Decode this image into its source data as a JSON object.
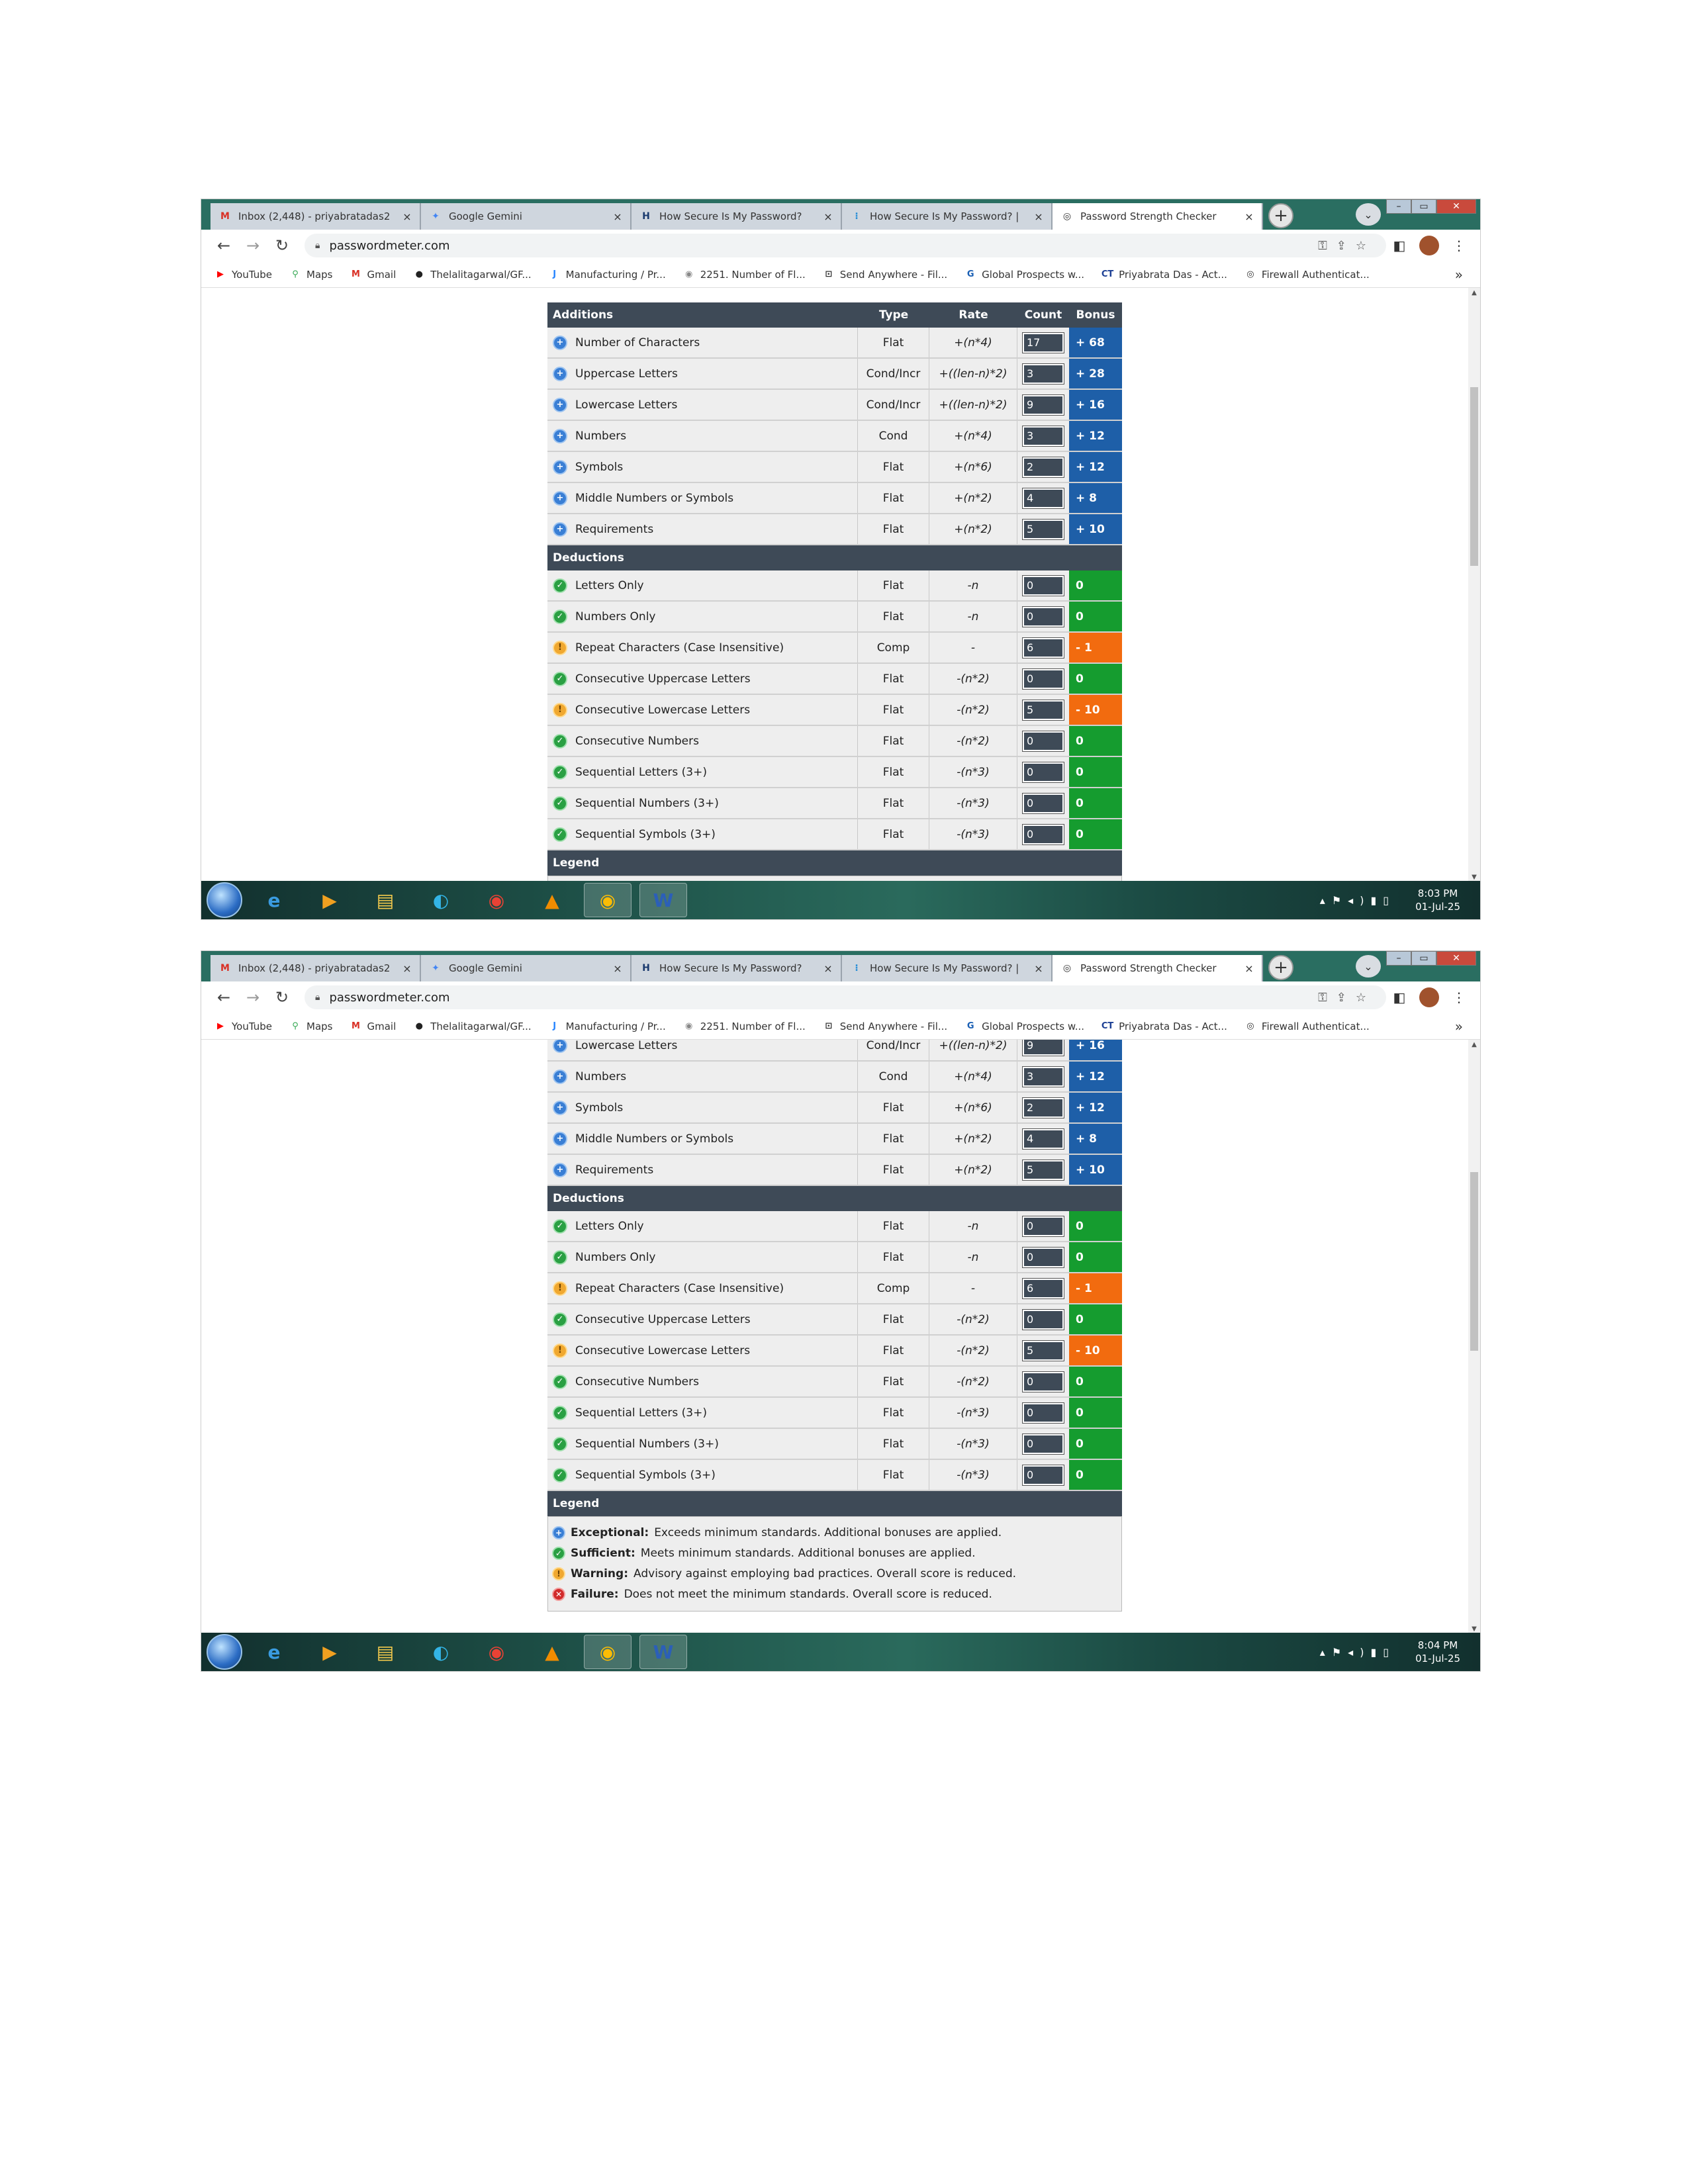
{
  "browser": {
    "tabs": [
      {
        "label": "Inbox (2,448) - priyabratadas2",
        "icon": "gmail-icon",
        "icon_glyph": "M",
        "icon_color": "#d93025",
        "active": false
      },
      {
        "label": "Google Gemini",
        "icon": "gemini-icon",
        "icon_glyph": "✦",
        "icon_color": "#4285f4",
        "active": false
      },
      {
        "label": "How Secure Is My Password?",
        "icon": "hsimp-icon",
        "icon_glyph": "H",
        "icon_color": "#1a3a6e",
        "active": false
      },
      {
        "label": "How Secure Is My Password? |",
        "icon": "hsimp-blue-icon",
        "icon_glyph": "⁝",
        "icon_color": "#2a8fd6",
        "active": false
      },
      {
        "label": "Password Strength Checker",
        "icon": "passwordmeter-icon",
        "icon_glyph": "◎",
        "icon_color": "#333333",
        "active": true
      }
    ],
    "close_glyph": "×",
    "new_tab_glyph": "+",
    "tab_dropdown_glyph": "⌄",
    "url": "passwordmeter.com",
    "bookmarks": [
      {
        "label": "YouTube",
        "icon": "youtube-icon",
        "glyph": "▶",
        "color": "#ff0000"
      },
      {
        "label": "Maps",
        "icon": "maps-icon",
        "glyph": "⚲",
        "color": "#34a853"
      },
      {
        "label": "Gmail",
        "icon": "gmail-icon",
        "glyph": "M",
        "color": "#d93025"
      },
      {
        "label": "Thelalitagarwal/GF...",
        "icon": "github-icon",
        "glyph": "●",
        "color": "#222222"
      },
      {
        "label": "Manufacturing / Pr...",
        "icon": "jira-icon",
        "glyph": "J",
        "color": "#2684ff"
      },
      {
        "label": "2251. Number of Fl...",
        "icon": "leetcode-icon",
        "glyph": "◉",
        "color": "#888888"
      },
      {
        "label": "Send Anywhere - Fil...",
        "icon": "sendanywhere-icon",
        "glyph": "⊡",
        "color": "#333333"
      },
      {
        "label": "Global Prospects w...",
        "icon": "global-prospects-icon",
        "glyph": "G",
        "color": "#1a5fb4"
      },
      {
        "label": "Priyabrata Das - Act...",
        "icon": "ct-icon",
        "glyph": "CT",
        "color": "#1c3f94"
      },
      {
        "label": "Firewall Authenticat...",
        "icon": "firewall-icon",
        "glyph": "◎",
        "color": "#333333"
      }
    ],
    "bookmarks_more": "»"
  },
  "meter": {
    "additions_header": {
      "name": "Additions",
      "type": "Type",
      "rate": "Rate",
      "count": "Count",
      "bonus": "Bonus"
    },
    "additions": [
      {
        "name": "Number of Characters",
        "type": "Flat",
        "rate": "+(n*4)",
        "count": "17",
        "bonus": "+ 68",
        "status": "exceptional"
      },
      {
        "name": "Uppercase Letters",
        "type": "Cond/Incr",
        "rate": "+((len-n)*2)",
        "count": "3",
        "bonus": "+ 28",
        "status": "exceptional"
      },
      {
        "name": "Lowercase Letters",
        "type": "Cond/Incr",
        "rate": "+((len-n)*2)",
        "count": "9",
        "bonus": "+ 16",
        "status": "exceptional"
      },
      {
        "name": "Numbers",
        "type": "Cond",
        "rate": "+(n*4)",
        "count": "3",
        "bonus": "+ 12",
        "status": "exceptional"
      },
      {
        "name": "Symbols",
        "type": "Flat",
        "rate": "+(n*6)",
        "count": "2",
        "bonus": "+ 12",
        "status": "exceptional"
      },
      {
        "name": "Middle Numbers or Symbols",
        "type": "Flat",
        "rate": "+(n*2)",
        "count": "4",
        "bonus": "+ 8",
        "status": "exceptional"
      },
      {
        "name": "Requirements",
        "type": "Flat",
        "rate": "+(n*2)",
        "count": "5",
        "bonus": "+ 10",
        "status": "exceptional"
      }
    ],
    "deductions_header": "Deductions",
    "deductions": [
      {
        "name": "Letters Only",
        "type": "Flat",
        "rate": "-n",
        "count": "0",
        "bonus": "0",
        "status": "sufficient"
      },
      {
        "name": "Numbers Only",
        "type": "Flat",
        "rate": "-n",
        "count": "0",
        "bonus": "0",
        "status": "sufficient"
      },
      {
        "name": "Repeat Characters (Case Insensitive)",
        "type": "Comp",
        "rate": "-",
        "count": "6",
        "bonus": "- 1",
        "status": "warning"
      },
      {
        "name": "Consecutive Uppercase Letters",
        "type": "Flat",
        "rate": "-(n*2)",
        "count": "0",
        "bonus": "0",
        "status": "sufficient"
      },
      {
        "name": "Consecutive Lowercase Letters",
        "type": "Flat",
        "rate": "-(n*2)",
        "count": "5",
        "bonus": "- 10",
        "status": "warning"
      },
      {
        "name": "Consecutive Numbers",
        "type": "Flat",
        "rate": "-(n*2)",
        "count": "0",
        "bonus": "0",
        "status": "sufficient"
      },
      {
        "name": "Sequential Letters (3+)",
        "type": "Flat",
        "rate": "-(n*3)",
        "count": "0",
        "bonus": "0",
        "status": "sufficient"
      },
      {
        "name": "Sequential Numbers (3+)",
        "type": "Flat",
        "rate": "-(n*3)",
        "count": "0",
        "bonus": "0",
        "status": "sufficient"
      },
      {
        "name": "Sequential Symbols (3+)",
        "type": "Flat",
        "rate": "-(n*3)",
        "count": "0",
        "bonus": "0",
        "status": "sufficient"
      }
    ],
    "legend_header": "Legend",
    "legend": [
      {
        "term": "Exceptional:",
        "text": "Exceeds minimum standards. Additional bonuses are applied.",
        "status": "exceptional"
      },
      {
        "term": "Sufficient:",
        "text": "Meets minimum standards. Additional bonuses are applied.",
        "status": "sufficient"
      },
      {
        "term": "Warning:",
        "text": "Advisory against employing bad practices. Overall score is reduced.",
        "status": "warning"
      },
      {
        "term": "Failure:",
        "text": "Does not meet the minimum standards. Overall score is reduced.",
        "status": "failure"
      }
    ],
    "status_colors": {
      "exceptional": "#1e5fa8",
      "sufficient": "#159c2f",
      "warning": "#f26b0f",
      "failure": "#d12a2a"
    },
    "status_glyphs": {
      "exceptional": "+",
      "sufficient": "✓",
      "warning": "!",
      "failure": "✕"
    }
  },
  "screenshots": [
    {
      "clock_time": "8:03 PM",
      "clock_date": "01-Jul-25"
    },
    {
      "clock_time": "8:04 PM",
      "clock_date": "01-Jul-25"
    }
  ],
  "taskbar_apps": [
    {
      "name": "ie-icon",
      "glyph": "e",
      "color": "#3a9be0"
    },
    {
      "name": "media-player-icon",
      "glyph": "▶",
      "color": "#f0a020"
    },
    {
      "name": "file-explorer-icon",
      "glyph": "▤",
      "color": "#f2c94c"
    },
    {
      "name": "edge-icon",
      "glyph": "◐",
      "color": "#33b4e6"
    },
    {
      "name": "chrome-icon",
      "glyph": "◉",
      "color": "#e94235"
    },
    {
      "name": "vlc-icon",
      "glyph": "▲",
      "color": "#f08c00"
    },
    {
      "name": "chrome-active-icon",
      "glyph": "◉",
      "color": "#fbbc05"
    },
    {
      "name": "word-icon",
      "glyph": "W",
      "color": "#2b5fb8"
    }
  ]
}
